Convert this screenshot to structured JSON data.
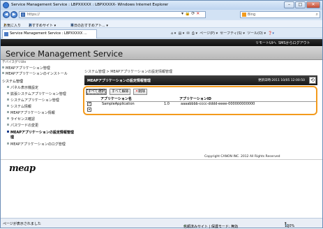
{
  "window": {
    "title": "Service Management Service : LBPXXXXX : LBPXXXXX- Windows Internet Explorer",
    "buttons": {
      "min": "–",
      "max": "□",
      "close": "✕"
    }
  },
  "address": {
    "url": "https://",
    "search_placeholder": "Bing"
  },
  "favorites": {
    "fav_label": "お気に入り",
    "suggested": "おすすめサイト ▾",
    "today": "本日のおすすめアト... ▾"
  },
  "tab": {
    "label": "Service Management Service : LBPXXXXX ..."
  },
  "tools_bar": {
    "page": "ページ(P) ▾",
    "safety": "セーフティ(S) ▾",
    "tools": "ツール(O) ▾"
  },
  "header": {
    "remote_ui": "リモートUIへ",
    "logout": "SMSからログアウト",
    "app_title": "Service Management Service",
    "user": "テバイスグリUIe"
  },
  "sidebar": {
    "items": [
      "MEAPアプリケーション管理",
      "MEAPアプリケーションのインストール",
      "システム管理",
      "パネル表示機設定",
      "拡張システムアプリケーション管理",
      "システムアプリケーション管理",
      "システム情報",
      "MEAPアプリケーション情報",
      "ライセンス確認",
      "パスワードの変更",
      "MEAPアプリケーションの設定情報管理",
      "理",
      "MEAPアプリケーションのログ管理"
    ]
  },
  "main": {
    "breadcrumb": "システム管理 > MEAPアプリケーションの設定情報管理",
    "title": "MEAPアプリケーションの設定情報管理",
    "updated": "更新日時:2011 10/05 12:00:50",
    "buttons": {
      "select_all": "すべて選択",
      "clear_all": "すべて解除",
      "delete": "削除"
    },
    "table": {
      "headers": [
        "アプリケーション名",
        "アプリケーションID"
      ],
      "rows": [
        {
          "name": "SampleApplication",
          "version": "1.0",
          "id": "aaaabbbb-cccc-dddd-eeee-000000000000"
        }
      ]
    }
  },
  "footer": {
    "copyright": "Copyright CANON INC. 2012 All Rights Reserved",
    "logo": "meap"
  },
  "statusbar": {
    "left": "ページが表示されました",
    "zone": "信頼済みサイト | 保護モード: 無効",
    "zoom": "100%"
  }
}
